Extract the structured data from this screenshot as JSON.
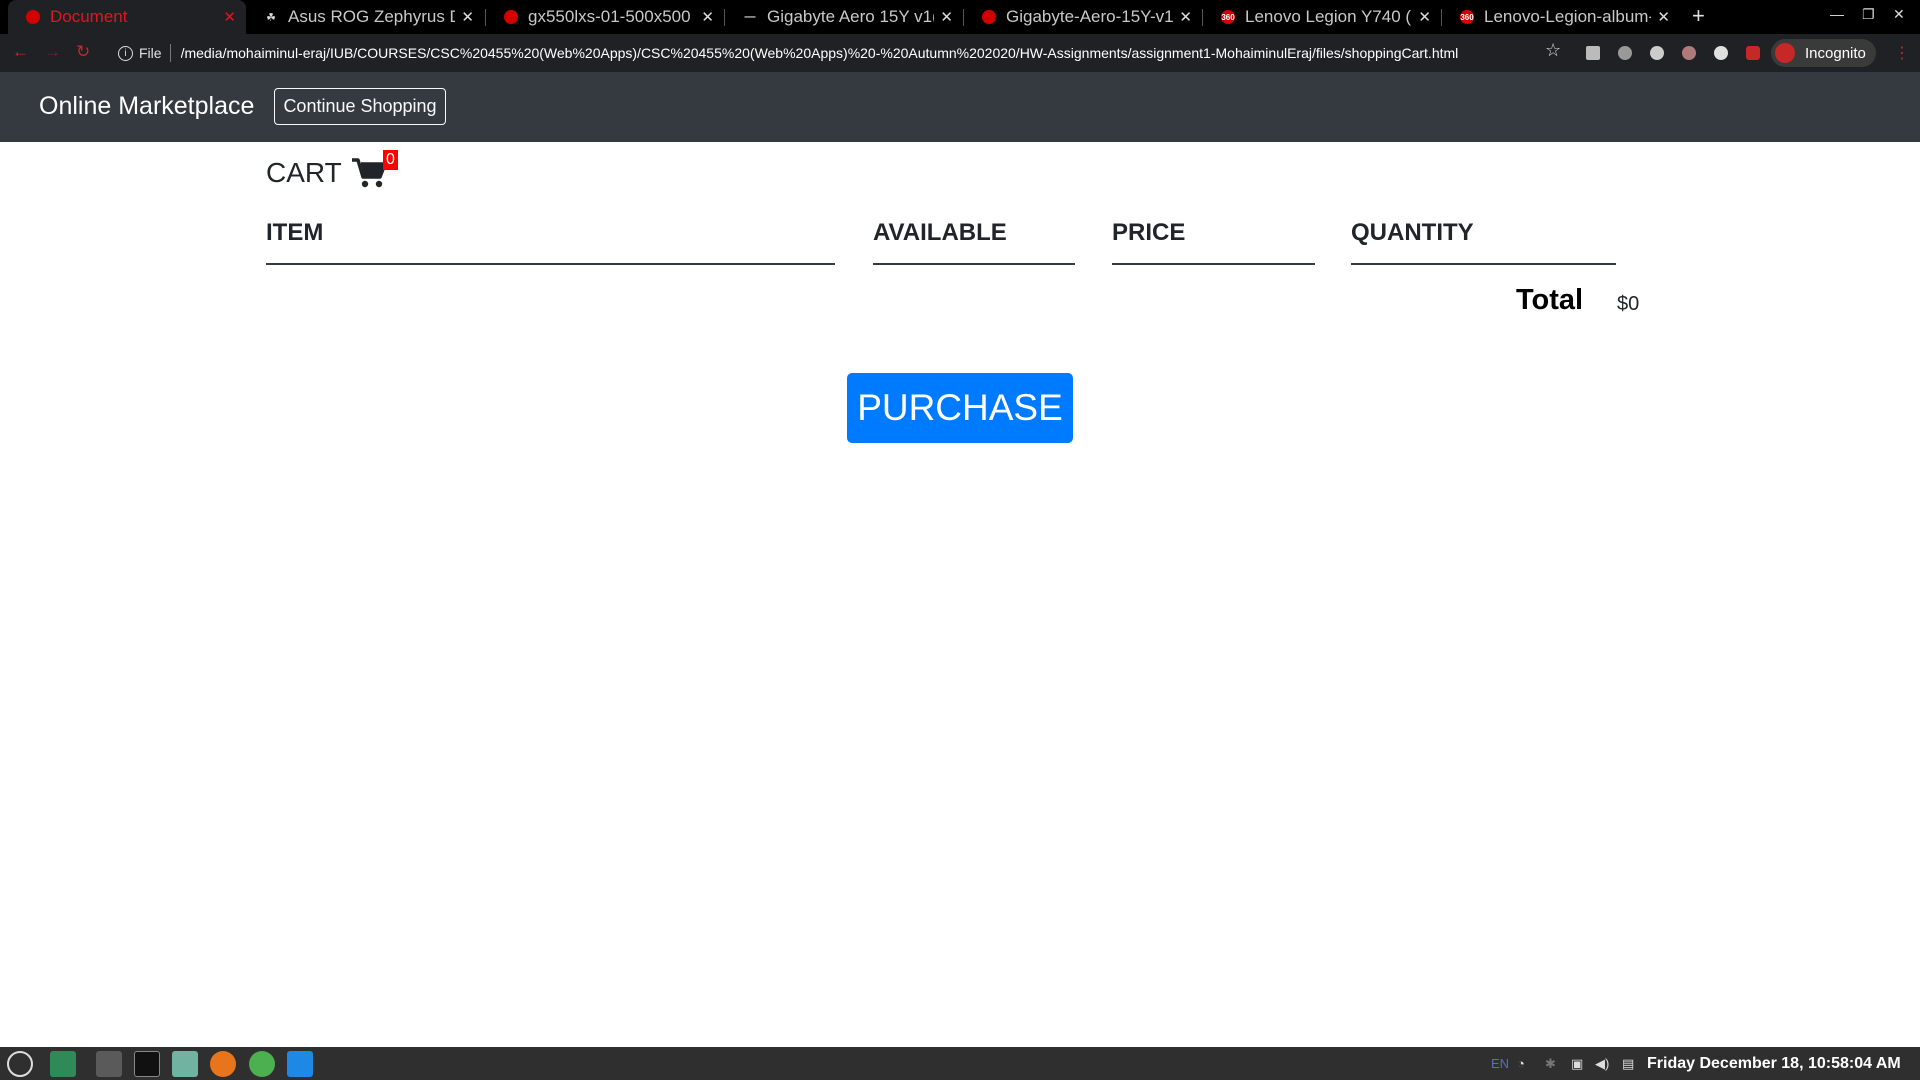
{
  "browser": {
    "tabs": [
      {
        "title": "Document",
        "favicon": "red-circle-icon",
        "active": true
      },
      {
        "title": "Asus ROG Zephyrus Du",
        "favicon": "site-favicon-icon",
        "active": false
      },
      {
        "title": "gx550lxs-01-500x500",
        "favicon": "red-circle-icon",
        "active": false
      },
      {
        "title": "Gigabyte Aero 15Y v1(",
        "favicon": "dash-favicon-icon",
        "active": false
      },
      {
        "title": "Gigabyte-Aero-15Y-v1",
        "favicon": "red-circle-icon",
        "active": false
      },
      {
        "title": "Lenovo Legion Y740 (E",
        "favicon": "360-favicon-icon",
        "active": false
      },
      {
        "title": "Lenovo-Legion-album-",
        "favicon": "360-favicon-icon",
        "active": false
      }
    ],
    "address": {
      "scheme_label": "File",
      "url": "/media/mohaiminul-eraj/IUB/COURSES/CSC%20455%20(Web%20Apps)/CSC%20455%20(Web%20Apps)%20-%20Autumn%202020/HW-Assignments/assignment1-MohaiminulEraj/files/shoppingCart.html"
    },
    "profile_label": "Incognito",
    "badge_360": "360"
  },
  "navbar": {
    "brand": "Online Marketplace",
    "continue_label": "Continue Shopping"
  },
  "cart": {
    "title": "CART",
    "badge_count": "0",
    "columns": [
      "ITEM",
      "AVAILABLE",
      "PRICE",
      "QUANTITY"
    ],
    "total_label": "Total",
    "total_value": "$0",
    "purchase_label": "PURCHASE"
  },
  "taskbar": {
    "lang": "EN",
    "clock": "Friday December 18, 10:58:04 AM"
  },
  "colors": {
    "navbar_bg": "#343a40",
    "primary": "#007bff",
    "badge": "#ff0000",
    "active_tab_text": "#e81123"
  }
}
